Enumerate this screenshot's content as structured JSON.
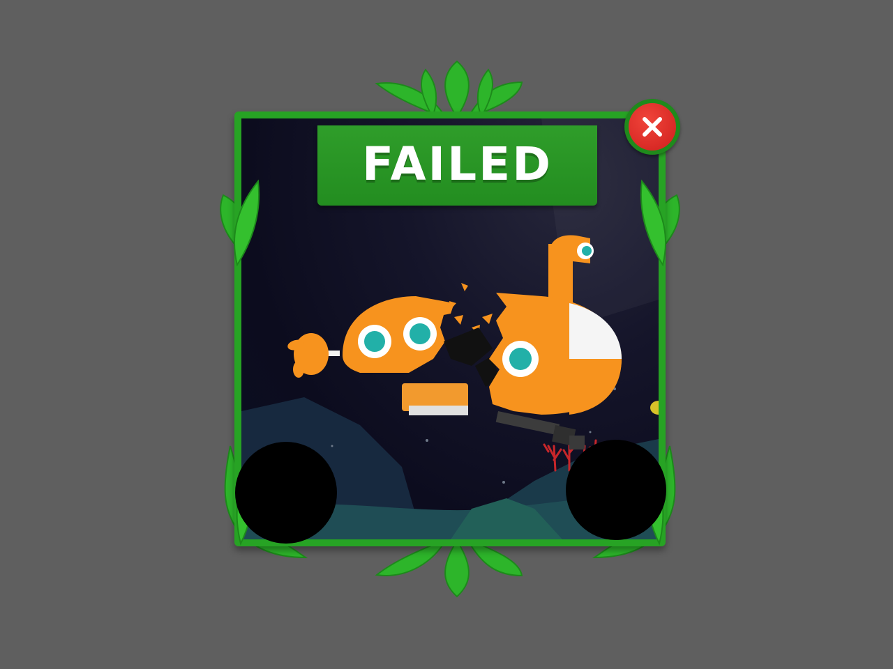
{
  "dialog": {
    "title": "FAILED",
    "status": "failed"
  },
  "close_button": {
    "icon": "close-icon"
  },
  "scene": {
    "subject": "broken-submarine",
    "setting": "deep-sea-night"
  },
  "colors": {
    "background": "#5f5f5f",
    "frame_green": "#27a324",
    "banner_green": "#2a9a26",
    "leaf_green": "#2db52a",
    "scene_dark": "#0d0d20",
    "submarine_orange": "#f7931e",
    "porthole_teal": "#22b0a8",
    "close_red": "#e2322b",
    "coral_red": "#c8262a"
  }
}
